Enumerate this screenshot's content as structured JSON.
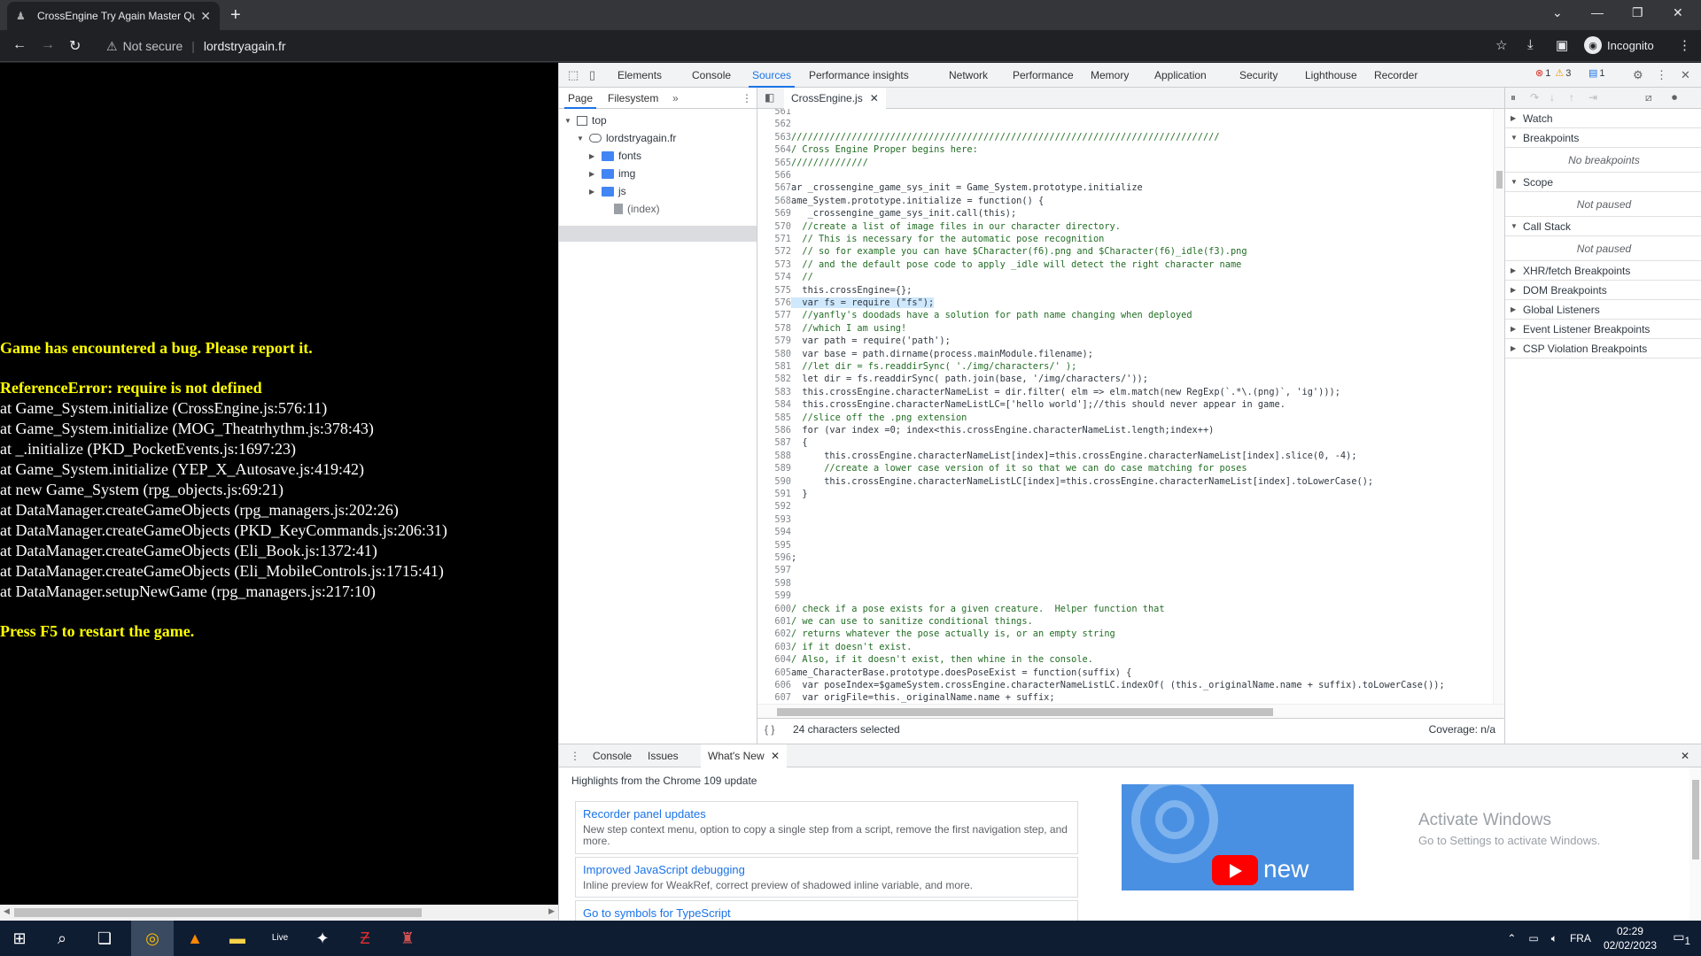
{
  "browser": {
    "tab_title": "CrossEngine Try Again Master Qu",
    "security_label": "Not secure",
    "url": "lordstryagain.fr",
    "profile_label": "Incognito"
  },
  "game": {
    "lines": [
      {
        "text": "Game has encountered a bug. Please report it.",
        "style": "yellow"
      },
      {
        "text": "ReferenceError: require is not defined",
        "style": "yellow"
      },
      {
        "text": "at Game_System.initialize (CrossEngine.js:576:11)",
        "style": "white"
      },
      {
        "text": "at Game_System.initialize (MOG_Theatrhythm.js:378:43)",
        "style": "white"
      },
      {
        "text": "at _.initialize (PKD_PocketEvents.js:1697:23)",
        "style": "white"
      },
      {
        "text": "at Game_System.initialize (YEP_X_Autosave.js:419:42)",
        "style": "white"
      },
      {
        "text": "at new Game_System (rpg_objects.js:69:21)",
        "style": "white"
      },
      {
        "text": "at DataManager.createGameObjects (rpg_managers.js:202:26)",
        "style": "white"
      },
      {
        "text": "at DataManager.createGameObjects (PKD_KeyCommands.js:206:31)",
        "style": "white"
      },
      {
        "text": "at DataManager.createGameObjects (Eli_Book.js:1372:41)",
        "style": "white"
      },
      {
        "text": "at DataManager.createGameObjects (Eli_MobileControls.js:1715:41)",
        "style": "white"
      },
      {
        "text": "at DataManager.setupNewGame (rpg_managers.js:217:10)",
        "style": "white"
      },
      {
        "text": "Press F5 to restart the game.",
        "style": "yellow"
      }
    ]
  },
  "devtools": {
    "tabs": [
      "Elements",
      "Console",
      "Sources",
      "Performance insights",
      "Network",
      "Performance",
      "Memory",
      "Application",
      "Security",
      "Lighthouse",
      "Recorder"
    ],
    "active_tab": "Sources",
    "errors_count": "1",
    "warnings_count": "3",
    "messages_count": "1",
    "navigator_tabs": [
      "Page",
      "Filesystem"
    ],
    "tree": {
      "top": "top",
      "domain": "lordstryagain.fr",
      "folders": [
        "fonts",
        "img",
        "js"
      ],
      "file": "(index)"
    },
    "open_file": "CrossEngine.js",
    "status_selection": "24 characters selected",
    "status_coverage": "Coverage: n/a",
    "debugger_panes": {
      "watch": "Watch",
      "breakpoints": "Breakpoints",
      "no_breakpoints": "No breakpoints",
      "scope": "Scope",
      "not_paused_scope": "Not paused",
      "call_stack": "Call Stack",
      "not_paused_stack": "Not paused",
      "xhr": "XHR/fetch Breakpoints",
      "dom": "DOM Breakpoints",
      "global": "Global Listeners",
      "event": "Event Listener Breakpoints",
      "csp": "CSP Violation Breakpoints"
    },
    "drawer": {
      "tabs": [
        "Console",
        "Issues",
        "What's New"
      ],
      "active_tab": "What's New",
      "heading": "Highlights from the Chrome 109 update",
      "cards": [
        {
          "title": "Recorder panel updates",
          "body": "New step context menu, option to copy a single step from a script, remove the first navigation step, and more."
        },
        {
          "title": "Improved JavaScript debugging",
          "body": "Inline preview for WeakRef, correct preview of shadowed inline variable, and more."
        },
        {
          "title": "Go to symbols for TypeScript",
          "body": ""
        }
      ],
      "video_label": "new"
    }
  },
  "code_lines": [
    {
      "n": "561",
      "t": ""
    },
    {
      "n": "562",
      "t": ""
    },
    {
      "n": "563",
      "t": "//////////////////////////////////////////////////////////////////////////////",
      "c": "cm"
    },
    {
      "n": "564",
      "t": "/ Cross Engine Proper begins here:",
      "c": "cm"
    },
    {
      "n": "565",
      "t": "//////////////",
      "c": "cm"
    },
    {
      "n": "566",
      "t": ""
    },
    {
      "n": "567",
      "t": "ar _crossengine_game_sys_init = Game_System.prototype.initialize"
    },
    {
      "n": "568",
      "t": "ame_System.prototype.initialize = function() {"
    },
    {
      "n": "569",
      "t": "   _crossengine_game_sys_init.call(this);"
    },
    {
      "n": "570",
      "t": "  //create a list of image files in our character directory.",
      "c": "cm"
    },
    {
      "n": "571",
      "t": "  // This is necessary for the automatic pose recognition",
      "c": "cm"
    },
    {
      "n": "572",
      "t": "  // so for example you can have $Character(f6).png and $Character(f6)_idle(f3).png",
      "c": "cm"
    },
    {
      "n": "573",
      "t": "  // and the default pose code to apply _idle will detect the right character name",
      "c": "cm"
    },
    {
      "n": "574",
      "t": "  //",
      "c": "cm"
    },
    {
      "n": "575",
      "t": "  this.crossEngine={};"
    },
    {
      "n": "576",
      "t": "  var fs = require (\"fs\");",
      "hl": true
    },
    {
      "n": "577",
      "t": "  //yanfly's doodads have a solution for path name changing when deployed",
      "c": "cm"
    },
    {
      "n": "578",
      "t": "  //which I am using!",
      "c": "cm"
    },
    {
      "n": "579",
      "t": "  var path = require('path');"
    },
    {
      "n": "580",
      "t": "  var base = path.dirname(process.mainModule.filename);"
    },
    {
      "n": "581",
      "t": "  //let dir = fs.readdirSync( './img/characters/' );",
      "c": "cm"
    },
    {
      "n": "582",
      "t": "  let dir = fs.readdirSync( path.join(base, '/img/characters/'));"
    },
    {
      "n": "583",
      "t": "  this.crossEngine.characterNameList = dir.filter( elm => elm.match(new RegExp(`.*\\.(png)`, 'ig')));"
    },
    {
      "n": "584",
      "t": "  this.crossEngine.characterNameListLC=['hello world'];//this should never appear in game."
    },
    {
      "n": "585",
      "t": "  //slice off the .png extension",
      "c": "cm"
    },
    {
      "n": "586",
      "t": "  for (var index =0; index<this.crossEngine.characterNameList.length;index++)"
    },
    {
      "n": "587",
      "t": "  {"
    },
    {
      "n": "588",
      "t": "      this.crossEngine.characterNameList[index]=this.crossEngine.characterNameList[index].slice(0, -4);"
    },
    {
      "n": "589",
      "t": "      //create a lower case version of it so that we can do case matching for poses",
      "c": "cm"
    },
    {
      "n": "590",
      "t": "      this.crossEngine.characterNameListLC[index]=this.crossEngine.characterNameList[index].toLowerCase();"
    },
    {
      "n": "591",
      "t": "  }"
    },
    {
      "n": "592",
      "t": ""
    },
    {
      "n": "593",
      "t": ""
    },
    {
      "n": "594",
      "t": ""
    },
    {
      "n": "595",
      "t": ""
    },
    {
      "n": "596",
      "t": ";"
    },
    {
      "n": "597",
      "t": ""
    },
    {
      "n": "598",
      "t": ""
    },
    {
      "n": "599",
      "t": ""
    },
    {
      "n": "600",
      "t": "/ check if a pose exists for a given creature.  Helper function that",
      "c": "cm"
    },
    {
      "n": "601",
      "t": "/ we can use to sanitize conditional things.",
      "c": "cm"
    },
    {
      "n": "602",
      "t": "/ returns whatever the pose actually is, or an empty string",
      "c": "cm"
    },
    {
      "n": "603",
      "t": "/ if it doesn't exist.",
      "c": "cm"
    },
    {
      "n": "604",
      "t": "/ Also, if it doesn't exist, then whine in the console.",
      "c": "cm"
    },
    {
      "n": "605",
      "t": "ame_CharacterBase.prototype.doesPoseExist = function(suffix) {"
    },
    {
      "n": "606",
      "t": "  var poseIndex=$gameSystem.crossEngine.characterNameListLC.indexOf( (this._originalName.name + suffix).toLowerCase());"
    },
    {
      "n": "607",
      "t": "  var origFile=this._originalName.name + suffix;"
    }
  ],
  "taskbar": {
    "lang": "FRA",
    "time": "02:29",
    "date": "02/02/2023",
    "notif_count": "1"
  },
  "activate": {
    "title": "Activate Windows",
    "sub": "Go to Settings to activate Windows."
  }
}
